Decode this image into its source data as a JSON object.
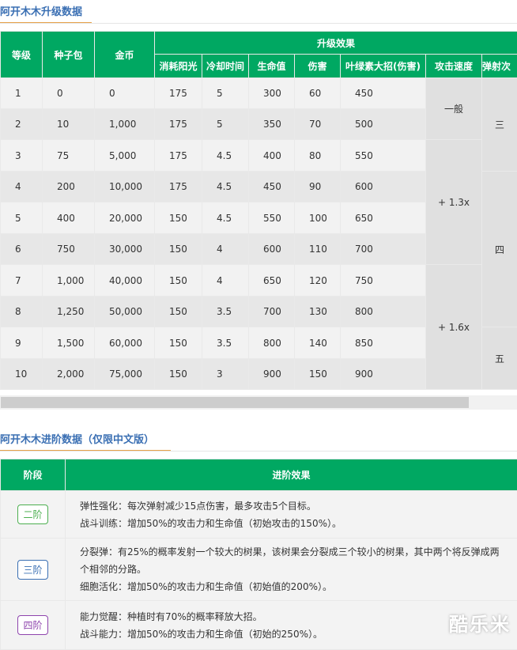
{
  "section1": {
    "title": "阿开木木升级数据"
  },
  "upgrade_table": {
    "headers": {
      "level": "等级",
      "seed_pack": "种子包",
      "gold": "金币",
      "effects_group": "升级效果",
      "sun_cost": "消耗阳光",
      "cooldown": "冷却时间",
      "hp": "生命值",
      "damage": "伤害",
      "ultimate": "叶绿素大招(伤害)",
      "attack_speed": "攻击速度",
      "bounce": "弹射次"
    },
    "rows": [
      {
        "level": "1",
        "seed": "0",
        "gold": "0",
        "sun": "175",
        "cd": "5",
        "hp": "300",
        "dmg": "60",
        "ult": "450"
      },
      {
        "level": "2",
        "seed": "10",
        "gold": "1,000",
        "sun": "175",
        "cd": "5",
        "hp": "350",
        "dmg": "70",
        "ult": "500"
      },
      {
        "level": "3",
        "seed": "75",
        "gold": "5,000",
        "sun": "175",
        "cd": "4.5",
        "hp": "400",
        "dmg": "80",
        "ult": "550"
      },
      {
        "level": "4",
        "seed": "200",
        "gold": "10,000",
        "sun": "175",
        "cd": "4.5",
        "hp": "450",
        "dmg": "90",
        "ult": "600"
      },
      {
        "level": "5",
        "seed": "400",
        "gold": "20,000",
        "sun": "150",
        "cd": "4.5",
        "hp": "550",
        "dmg": "100",
        "ult": "650"
      },
      {
        "level": "6",
        "seed": "750",
        "gold": "30,000",
        "sun": "150",
        "cd": "4",
        "hp": "600",
        "dmg": "110",
        "ult": "700"
      },
      {
        "level": "7",
        "seed": "1,000",
        "gold": "40,000",
        "sun": "150",
        "cd": "4",
        "hp": "650",
        "dmg": "120",
        "ult": "750"
      },
      {
        "level": "8",
        "seed": "1,250",
        "gold": "50,000",
        "sun": "150",
        "cd": "3.5",
        "hp": "700",
        "dmg": "130",
        "ult": "800"
      },
      {
        "level": "9",
        "seed": "1,500",
        "gold": "60,000",
        "sun": "150",
        "cd": "3.5",
        "hp": "800",
        "dmg": "140",
        "ult": "850"
      },
      {
        "level": "10",
        "seed": "2,000",
        "gold": "75,000",
        "sun": "150",
        "cd": "3",
        "hp": "900",
        "dmg": "150",
        "ult": "900"
      }
    ],
    "attack_speed_groups": [
      "一般",
      "+ 1.3x",
      "+ 1.6x"
    ],
    "bounce_groups": [
      "三",
      "四",
      "五"
    ]
  },
  "scrollbar": {
    "thumb_fraction": 0.905
  },
  "section2": {
    "title": "阿开木木进阶数据（仅限中文版）"
  },
  "advance_table": {
    "headers": {
      "stage": "阶段",
      "effect": "进阶效果"
    },
    "rows": [
      {
        "stage": "二阶",
        "color": "#4caf50",
        "lines": [
          "弹性强化：每次弹射减少15点伤害，最多攻击5个目标。",
          "战斗训练：增加50%的攻击力和生命值（初始攻击的150%）。"
        ]
      },
      {
        "stage": "三阶",
        "color": "#3a6fb3",
        "lines": [
          "分裂弹：有25%的概率发射一个较大的树果，该树果会分裂成三个较小的树果，其中两个将反弹成两个相邻的分路。",
          "细胞活化：增加50%的攻击力和生命值（初始值的200%）。"
        ]
      },
      {
        "stage": "四阶",
        "color": "#8e44ad",
        "lines": [
          "能力觉醒：种植时有70%的概率释放大招。",
          "战斗能力：增加50%的攻击力和生命值（初始的250%）。"
        ]
      }
    ]
  },
  "watermark": {
    "text": "酷乐米"
  },
  "colors": {
    "header_green": "#00a862",
    "title_blue": "#3a6fb3",
    "underline_orange": "#e7a24a"
  }
}
